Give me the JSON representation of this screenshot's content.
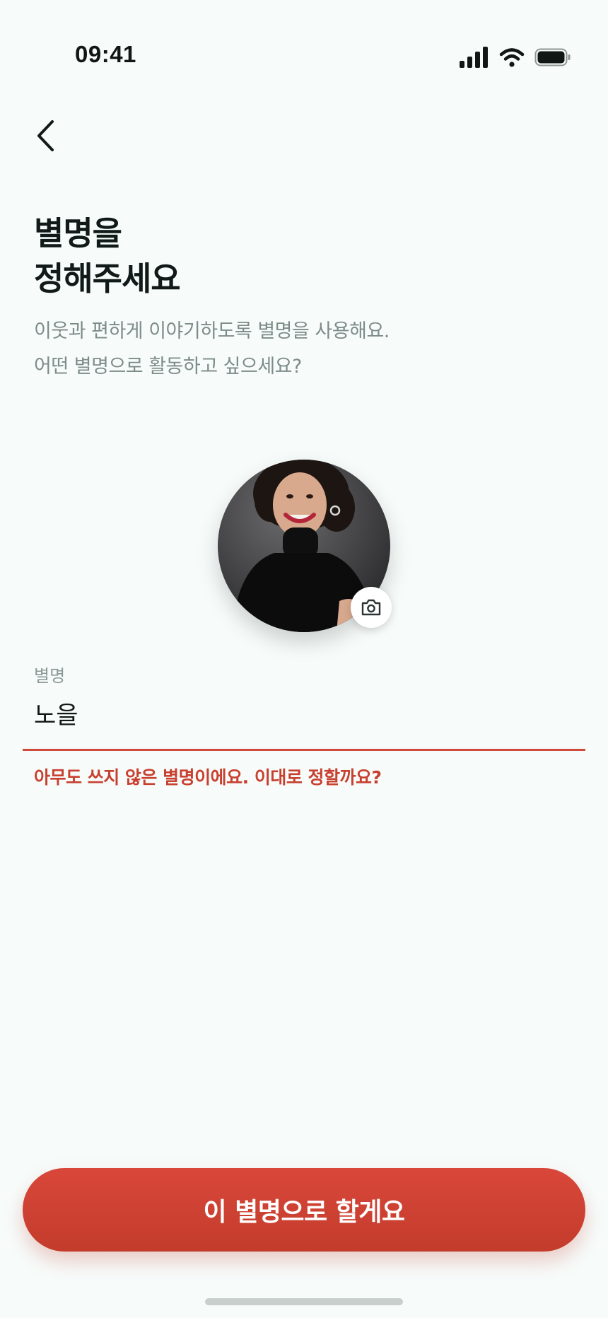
{
  "status_bar": {
    "time": "09:41",
    "icons": [
      "cellular-signal-icon",
      "wifi-icon",
      "battery-icon"
    ]
  },
  "nav": {
    "back_icon": "chevron-left-icon"
  },
  "header": {
    "title_line1": "별명을",
    "title_line2": "정해주세요",
    "subtitle_line1": "이웃과 편하게 이야기하도록 별명을 사용해요.",
    "subtitle_line2": "어떤 별명으로 활동하고 싶으세요?"
  },
  "profile": {
    "photo": "profile-photo",
    "camera_icon": "camera-icon"
  },
  "nickname_field": {
    "label": "별명",
    "value": "노을",
    "message": "아무도 쓰지 않은 별명이에요. 이대로 정할까요?"
  },
  "confirm_button": {
    "label": "이 별명으로 할게요"
  },
  "colors": {
    "background": "#f7fcfb",
    "accent": "#cf4a3d",
    "error_text": "#c8402f",
    "subtitle_text": "#7d8b89"
  }
}
